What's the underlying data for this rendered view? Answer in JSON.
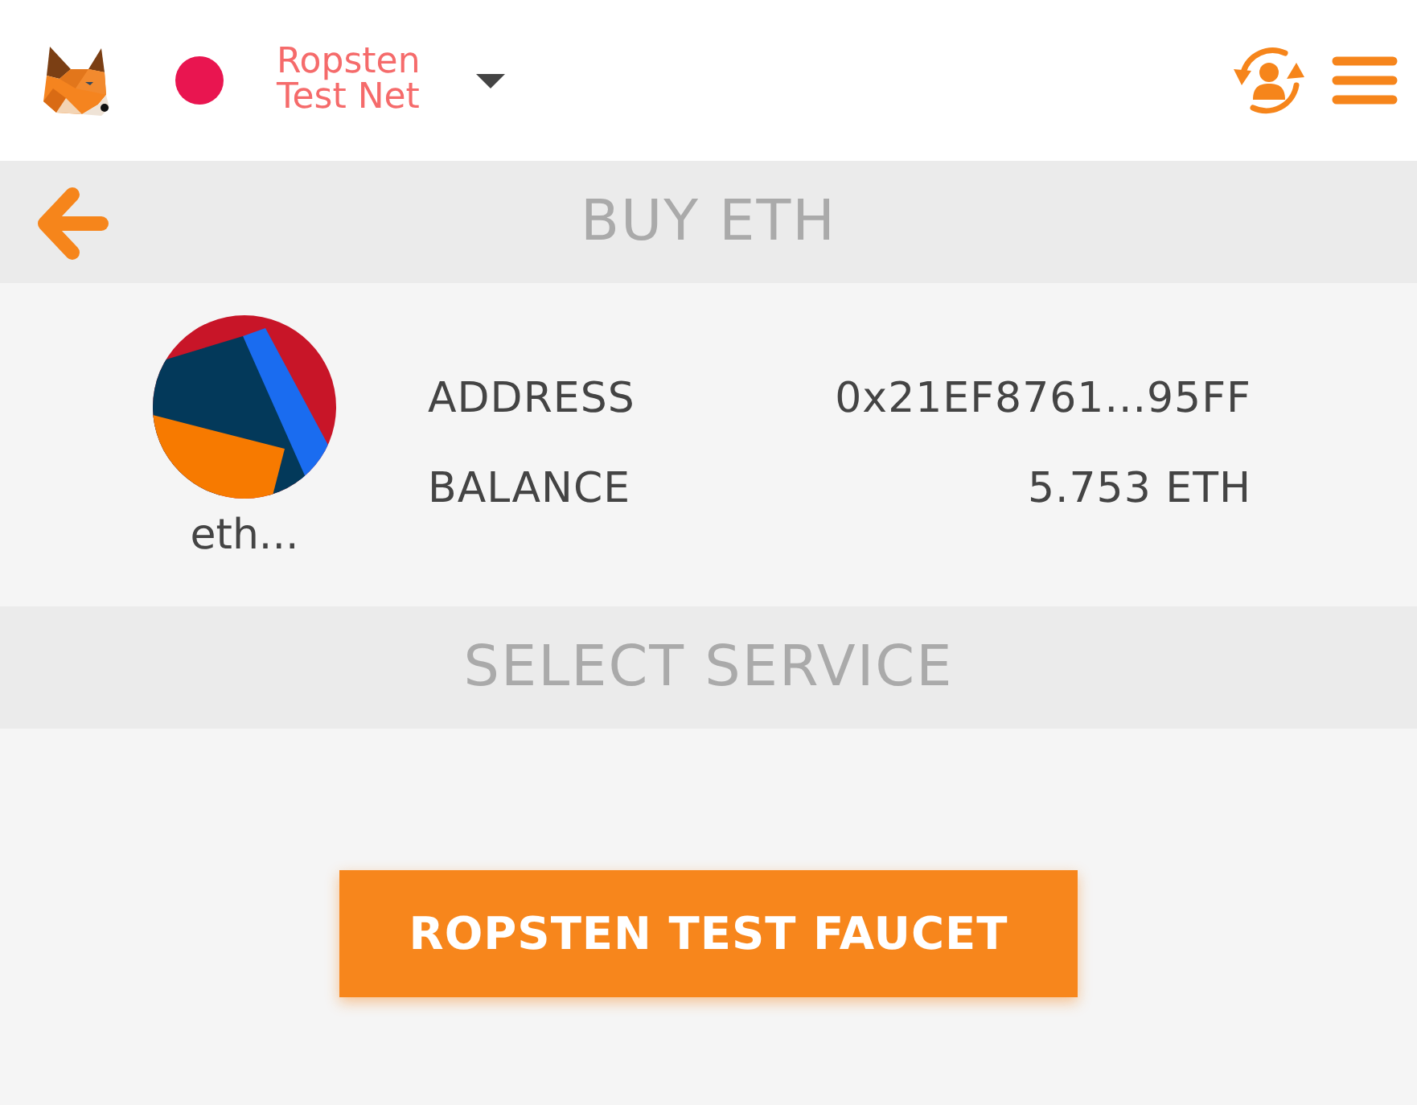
{
  "header": {
    "network": {
      "name": "Ropsten Test Net",
      "color": "#e91550"
    }
  },
  "buy_section": {
    "title": "BUY ETH"
  },
  "account": {
    "name": "eth...",
    "rows": [
      {
        "label": "ADDRESS",
        "value": "0x21EF8761...95FF"
      },
      {
        "label": "BALANCE",
        "value": "5.753 ETH"
      }
    ]
  },
  "service_section": {
    "title": "SELECT SERVICE",
    "buttons": [
      {
        "label": "ROPSTEN TEST FAUCET"
      }
    ]
  }
}
